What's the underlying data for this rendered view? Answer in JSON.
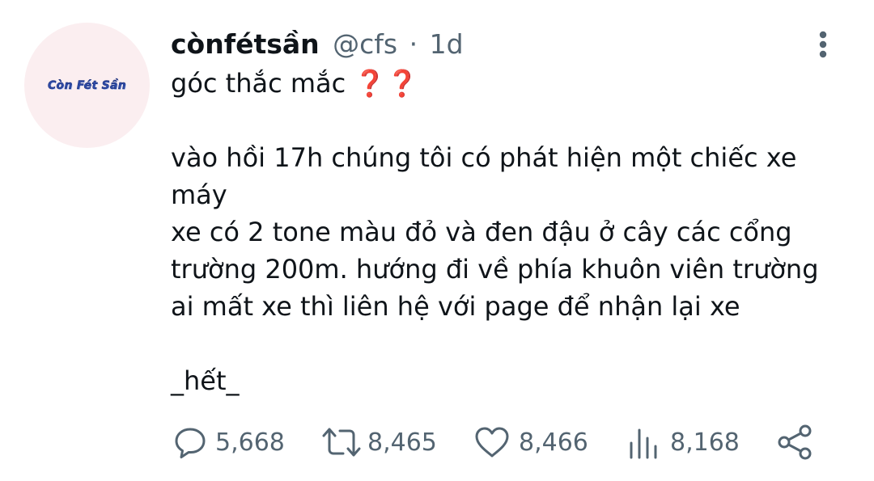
{
  "avatar": {
    "logo_text": "Còn Fét Sần"
  },
  "header": {
    "display_name": "cònfétsần",
    "handle": "@cfs",
    "separator": "·",
    "time": "1d"
  },
  "icons": {
    "more": "more-vertical-icon",
    "reply": "speech-bubble-icon",
    "retweet": "retweet-icon",
    "like": "heart-icon",
    "views": "bar-chart-icon",
    "share": "share-icon"
  },
  "body": {
    "line1_text": "góc thắc mắc ",
    "line1_emoji": "❓❓",
    "line2": "vào hồi 17h chúng tôi có phát hiện một chiếc xe máy",
    "line3": "xe có 2 tone màu đỏ và đen đậu ở cây các cổng trường 200m. hướng đi về phía khuôn viên trường",
    "line4": "ai mất xe thì liên hệ với page để nhận lại xe",
    "line5": "_hết_"
  },
  "actions": {
    "replies": "5,668",
    "retweets": "8,465",
    "likes": "8,466",
    "views": "8,168"
  },
  "colors": {
    "text": "#0f1419",
    "secondary": "#536471",
    "emoji_red": "#e0245e",
    "avatar_bg": "#fbeef0"
  }
}
